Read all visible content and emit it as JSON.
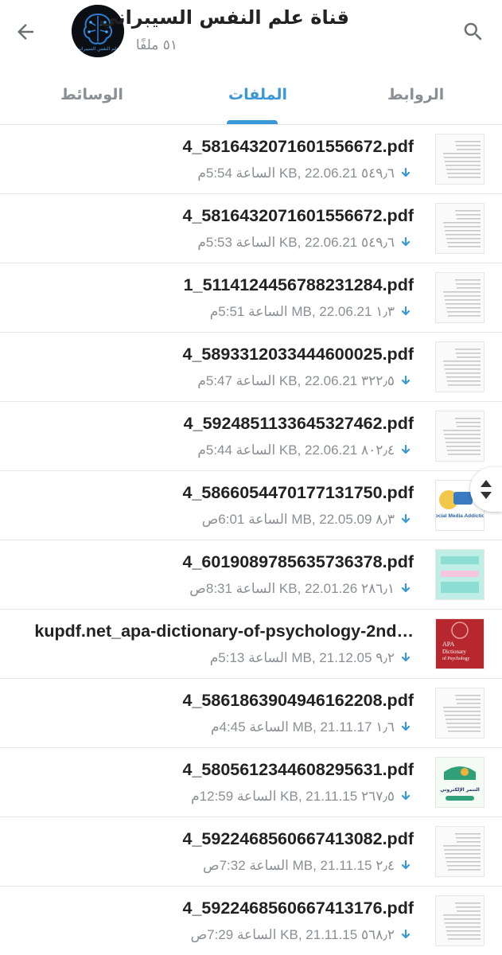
{
  "header": {
    "title": "قناة علم النفس السيبراني",
    "subtitle": "٥١ ملفًا",
    "avatar_text": "علم النفس السيبراني"
  },
  "tabs": [
    {
      "label": "الوسائط",
      "active": false
    },
    {
      "label": "الملفات",
      "active": true
    },
    {
      "label": "الروابط",
      "active": false
    }
  ],
  "files": [
    {
      "name": "4_5816432071601556672.pdf",
      "meta": "٥٤٩٫٦ KB, 22.06.21 الساعة 5:54م",
      "thumb": "doc"
    },
    {
      "name": "4_5816432071601556672.pdf",
      "meta": "٥٤٩٫٦ KB, 22.06.21 الساعة 5:53م",
      "thumb": "doc"
    },
    {
      "name": "1_5114124456788231284.pdf",
      "meta": "١٫٣ MB, 22.06.21 الساعة 5:51م",
      "thumb": "doc"
    },
    {
      "name": "4_5893312033444600025.pdf",
      "meta": "٣٢٢٫٥ KB, 22.06.21 الساعة 5:47م",
      "thumb": "doc"
    },
    {
      "name": "4_5924851133645327462.pdf",
      "meta": "٨٠٢٫٤ KB, 22.06.21 الساعة 5:44م",
      "thumb": "doc"
    },
    {
      "name": "4_5866054470177131750.pdf",
      "meta": "٨٫٣ MB, 22.05.09 الساعة 6:01ص",
      "thumb": "social",
      "thumb_label": "Social Media Addiction"
    },
    {
      "name": "4_6019089785635736378.pdf",
      "meta": "٢٨٦٫١ KB, 22.01.26 الساعة 8:31ص",
      "thumb": "teal"
    },
    {
      "name": "kupdf.net_apa-dictionary-of-psychology-2nd…",
      "meta": "٩٫٢ MB, 21.12.05 الساعة 5:13م",
      "thumb": "apa",
      "thumb_label": "APA Dictionary of Psychology"
    },
    {
      "name": "4_5861863904946162208.pdf",
      "meta": "١٫٦ MB, 21.11.17 الساعة 4:45م",
      "thumb": "doc"
    },
    {
      "name": "4_5805612344608295631.pdf",
      "meta": "٢٦٧٫٥ KB, 21.11.15 الساعة 12:59م",
      "thumb": "poster",
      "thumb_label": "التنمر الإلكتروني"
    },
    {
      "name": "4_5922468560667413082.pdf",
      "meta": "٢٫٤ MB, 21.11.15 الساعة 7:32ص",
      "thumb": "doc"
    },
    {
      "name": "4_5922468560667413176.pdf",
      "meta": "٥٦٨٫٢ KB, 21.11.15 الساعة 7:29ص",
      "thumb": "doc"
    }
  ],
  "colors": {
    "accent": "#3a97d8",
    "text": "#222222",
    "muted": "#8a8f95"
  },
  "icons": [
    "back-arrow-icon",
    "search-icon",
    "download-icon",
    "scroll-updown-icon"
  ]
}
